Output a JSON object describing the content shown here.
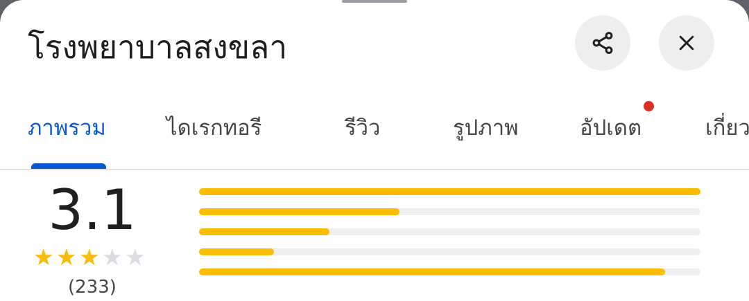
{
  "place": {
    "title": "โรงพยาบาลสงขลา"
  },
  "actions": {
    "share_icon": "share-icon",
    "close_icon": "close-icon"
  },
  "tabs": [
    {
      "label": "ภาพรวม",
      "active": true
    },
    {
      "label": "ไดเรกทอรี",
      "active": false
    },
    {
      "label": "รีวิว",
      "active": false
    },
    {
      "label": "รูปภาพ",
      "active": false
    },
    {
      "label": "อัปเดต",
      "active": false,
      "has_notification_dot": true
    },
    {
      "label": "เกี่ยว",
      "active": false
    }
  ],
  "rating": {
    "value": "3.1",
    "stars": 3.1,
    "max_stars": 5,
    "count_text": "(233)",
    "distribution": [
      {
        "stars": 5,
        "fraction": 1.0
      },
      {
        "stars": 4,
        "fraction": 0.4
      },
      {
        "stars": 3,
        "fraction": 0.26
      },
      {
        "stars": 2,
        "fraction": 0.15
      },
      {
        "stars": 1,
        "fraction": 0.93
      }
    ]
  },
  "colors": {
    "accent": "#0b57d0",
    "star": "#fbbc04",
    "notification_dot": "#d93025",
    "bar_track": "#efefef"
  }
}
